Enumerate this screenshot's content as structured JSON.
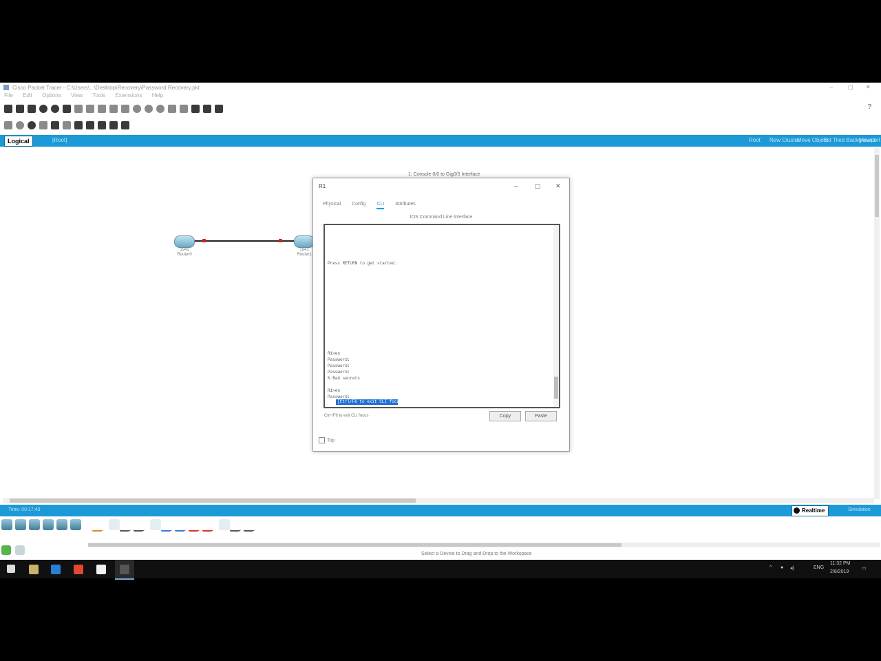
{
  "window": {
    "title": "Cisco Packet Tracer - C:\\Users\\...\\Desktop\\Recovery\\Password Recovery.pkt",
    "minimize": "–",
    "maximize": "▢",
    "close": "✕"
  },
  "menu": [
    "File",
    "Edit",
    "Options",
    "View",
    "Tools",
    "Extensions",
    "Help"
  ],
  "tabs": {
    "logical": "Logical",
    "root_path": "[Root]",
    "right_items": [
      "Root",
      "New Cluster",
      "Move Object",
      "Set Tiled Background",
      "Viewport"
    ]
  },
  "devices": [
    {
      "name": "Router0",
      "model": "1941"
    },
    {
      "name": "Router1",
      "model": "1941"
    }
  ],
  "tooltip": "1: Console 0/0 to Gig0/0 Interface",
  "dialog": {
    "title": "R1",
    "tabs": [
      "Physical",
      "Config",
      "CLI",
      "Attributes"
    ],
    "active_tab": "CLI",
    "heading": "IOS Command Line Interface",
    "console_lines": [
      "Press RETURN to get started.",
      "R1>en",
      "Password:",
      "Password:",
      "Password:",
      "% Bad secrets",
      "R1>en",
      "Password:"
    ],
    "selected_text": "[Ctrl+F6 to exit CLI focus]",
    "hint": "Ctrl+F6 to exit CLI focus",
    "copy_button": "Copy",
    "paste_button": "Paste",
    "top_checkbox": "Top"
  },
  "bottom": {
    "time": "Time: 00:17:43",
    "realtime_label": "Realtime",
    "simulation_label": "Simulation"
  },
  "status": "Select a Device to Drag and Drop to the Workspace",
  "taskbar": {
    "time": "11:32 PM",
    "date": "2/8/2019",
    "lang": "ENG"
  }
}
